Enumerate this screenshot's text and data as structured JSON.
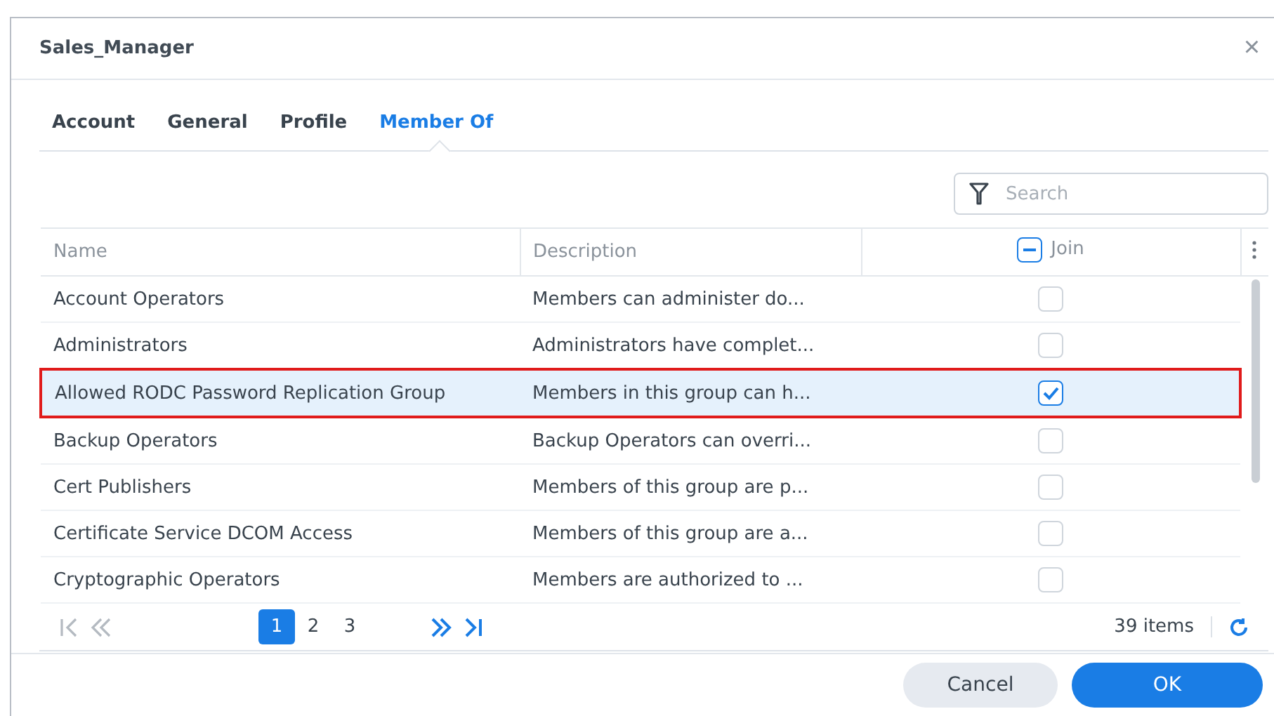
{
  "window": {
    "title": "Sales_Manager",
    "close": "×"
  },
  "tabs": [
    {
      "label": "Account",
      "selected": false
    },
    {
      "label": "General",
      "selected": false
    },
    {
      "label": "Profile",
      "selected": false
    },
    {
      "label": "Member Of",
      "selected": true
    }
  ],
  "search": {
    "placeholder": "Search"
  },
  "table": {
    "columns": [
      {
        "label": "Name",
        "kind": "text"
      },
      {
        "label": "Description",
        "kind": "text"
      },
      {
        "label": "Join",
        "kind": "check",
        "checked": false,
        "indeterminate": true
      }
    ],
    "rows": [
      {
        "name": "Account Operators",
        "description": "Members can administer do...",
        "join": false,
        "selected": false,
        "outlined": false
      },
      {
        "name": "Administrators",
        "description": "Administrators have complet...",
        "join": false,
        "selected": false,
        "outlined": false
      },
      {
        "name": "Allowed RODC Password Replication Group",
        "description": "Members in this group can h...",
        "join": true,
        "selected": true,
        "outlined": true
      },
      {
        "name": "Backup Operators",
        "description": "Backup Operators can overri...",
        "join": false,
        "selected": false,
        "outlined": false
      },
      {
        "name": "Cert Publishers",
        "description": "Members of this group are p...",
        "join": false,
        "selected": false,
        "outlined": false
      },
      {
        "name": "Certificate Service DCOM Access",
        "description": "Members of this group are a...",
        "join": false,
        "selected": false,
        "outlined": false
      },
      {
        "name": "Cryptographic Operators",
        "description": "Members are authorized to ...",
        "join": false,
        "selected": false,
        "outlined": false
      }
    ]
  },
  "pagination": {
    "pages": [
      {
        "label": "1",
        "selected": true
      },
      {
        "label": "2",
        "selected": false
      },
      {
        "label": "3",
        "selected": false
      }
    ],
    "count": "39 items"
  },
  "buttons": [
    {
      "label": "Cancel",
      "kind": "secondary"
    },
    {
      "label": "OK",
      "kind": "primary"
    }
  ]
}
